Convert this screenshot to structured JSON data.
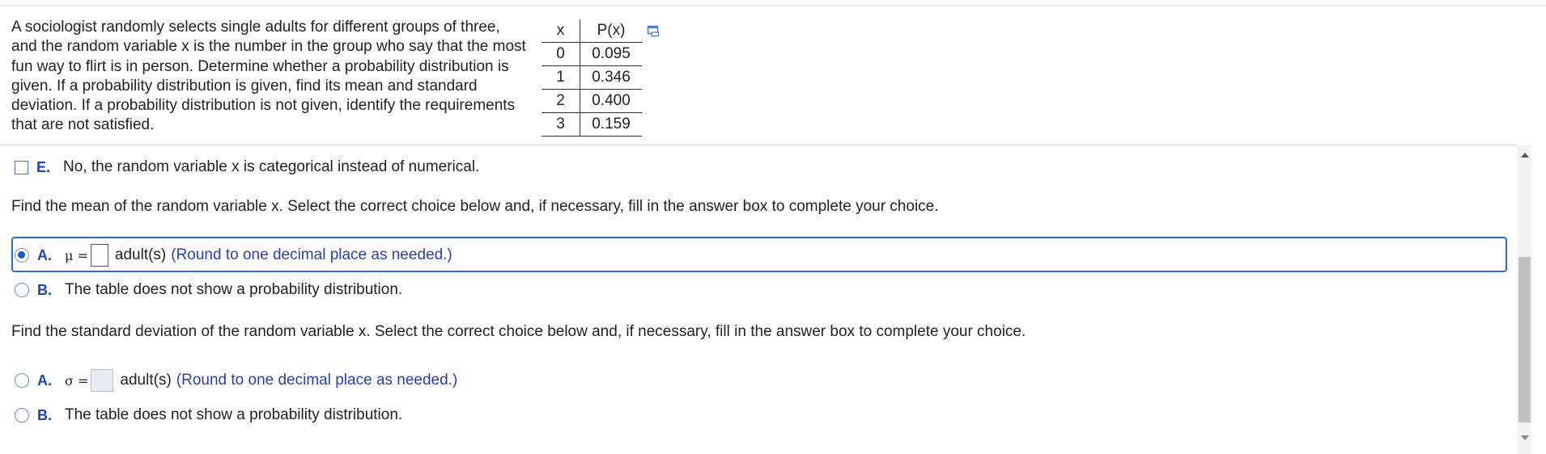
{
  "question": {
    "text": "A sociologist randomly selects single adults for different groups of three, and the random variable x is the number in the group who say that the most fun way to flirt is in person. Determine whether a probability distribution is given. If a probability distribution is given, find its mean and standard deviation. If a probability distribution is not given, identify the requirements that are not satisfied."
  },
  "table": {
    "headers": [
      "x",
      "P(x)"
    ],
    "rows": [
      [
        "0",
        "0.095"
      ],
      [
        "1",
        "0.346"
      ],
      [
        "2",
        "0.400"
      ],
      [
        "3",
        "0.159"
      ]
    ],
    "expand_icon": "expand-table-icon"
  },
  "part1": {
    "option_e": {
      "letter": "E.",
      "text": "No, the random variable x is categorical instead of numerical.",
      "checked": false
    }
  },
  "part2": {
    "prompt": "Find the mean of the random variable x. Select the correct choice below and, if necessary, fill in the answer box to complete your choice.",
    "option_a": {
      "letter": "A.",
      "symbol": "μ =",
      "unit": "adult(s)",
      "hint": "(Round to one decimal place as needed.)",
      "value": "",
      "selected": true
    },
    "option_b": {
      "letter": "B.",
      "text": "The table does not show a probability distribution.",
      "selected": false
    }
  },
  "part3": {
    "prompt": "Find the standard deviation of the random variable x. Select the correct choice below and, if necessary, fill in the answer box to complete your choice.",
    "option_a": {
      "letter": "A.",
      "symbol": "σ =",
      "unit": "adult(s)",
      "hint": "(Round to one decimal place as needed.)",
      "value": "",
      "selected": false
    },
    "option_b": {
      "letter": "B.",
      "text": "The table does not show a probability distribution.",
      "selected": false
    }
  },
  "colors": {
    "accent": "#2f6bd6",
    "option_letter": "#1a46b6",
    "hint_text": "#2b3faa"
  }
}
